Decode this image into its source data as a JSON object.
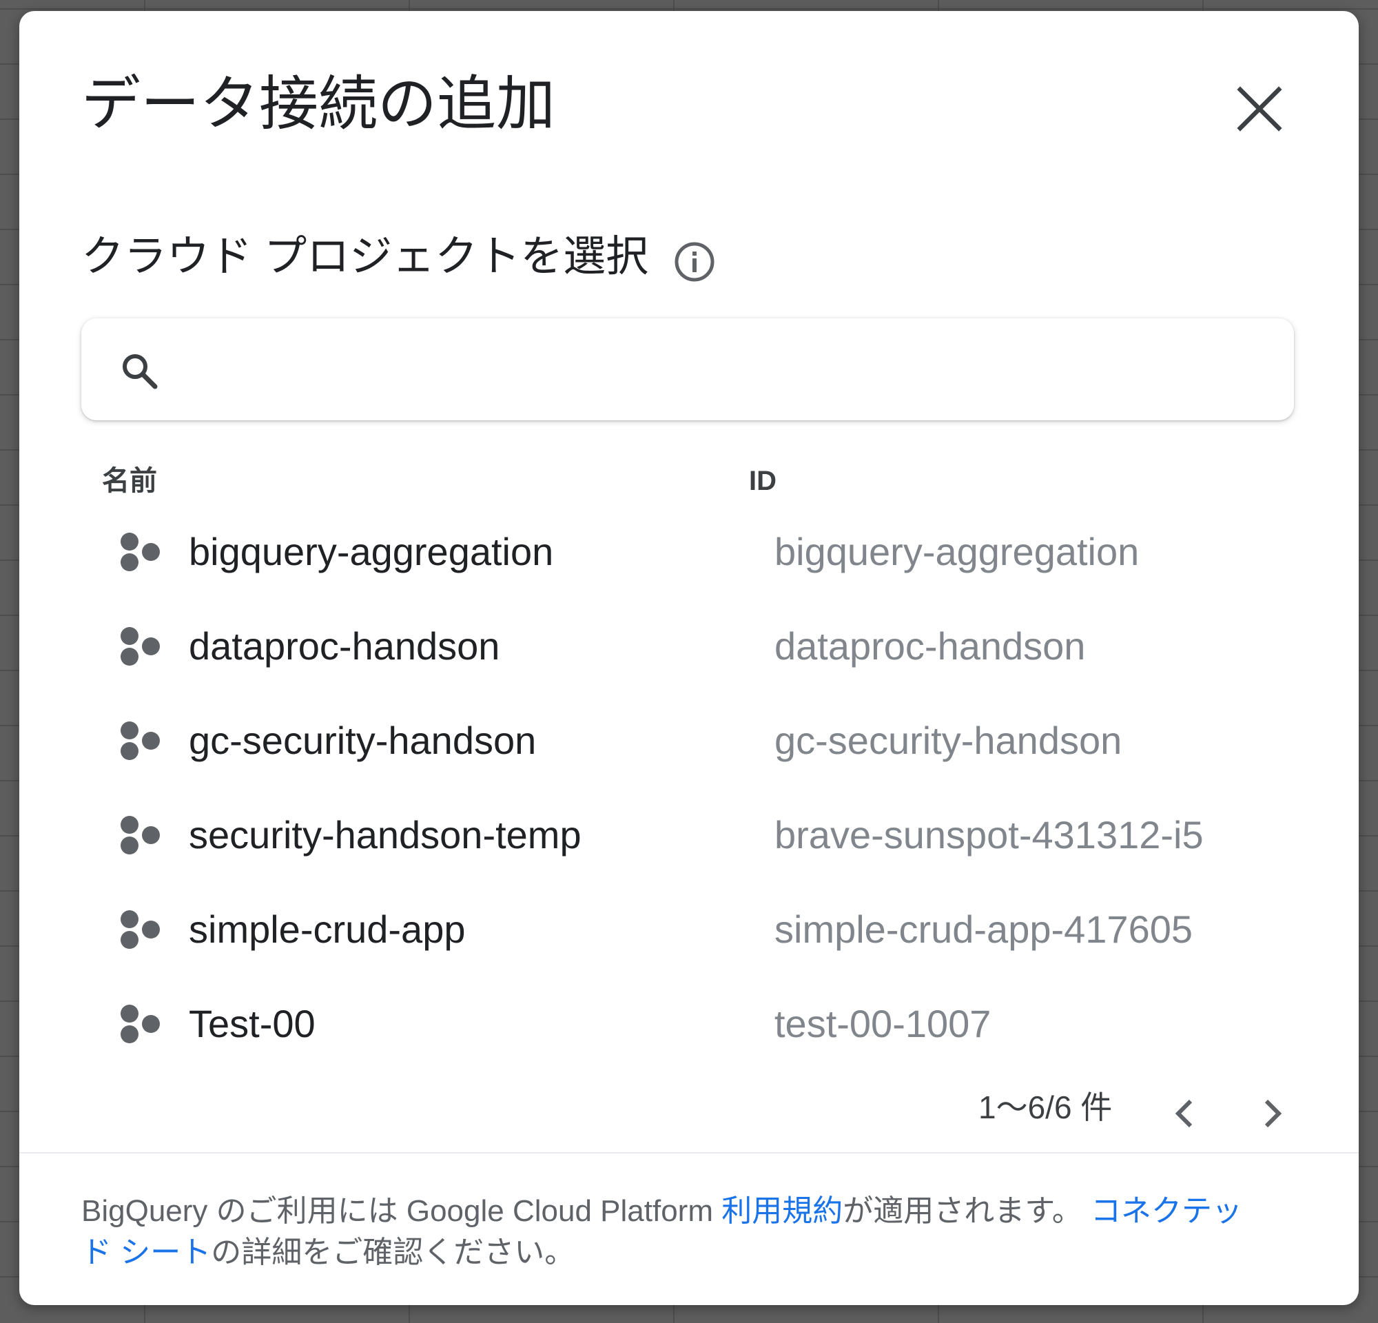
{
  "dialog": {
    "title": "データ接続の追加",
    "close_icon": "close-icon"
  },
  "section": {
    "label": "クラウド プロジェクトを選択",
    "info_icon": "info-icon"
  },
  "search": {
    "icon": "search-icon",
    "value": "",
    "placeholder": ""
  },
  "table": {
    "columns": [
      "名前",
      "ID"
    ],
    "rows": [
      {
        "name": "bigquery-aggregation",
        "id": "bigquery-aggregation",
        "icon": "project-icon"
      },
      {
        "name": "dataproc-handson",
        "id": "dataproc-handson",
        "icon": "project-icon"
      },
      {
        "name": "gc-security-handson",
        "id": "gc-security-handson",
        "icon": "project-icon"
      },
      {
        "name": "security-handson-temp",
        "id": "brave-sunspot-431312-i5",
        "icon": "project-icon"
      },
      {
        "name": "simple-crud-app",
        "id": "simple-crud-app-417605",
        "icon": "project-icon"
      },
      {
        "name": "Test-00",
        "id": "test-00-1007",
        "icon": "project-icon"
      }
    ]
  },
  "pagination": {
    "text": "1～6/6 件",
    "prev_icon": "chevron-left-icon",
    "next_icon": "chevron-right-icon"
  },
  "footer": {
    "text_before": "BigQuery のご利用には Google Cloud Platform ",
    "terms_link": "利用規約",
    "text_middle": "が適用されます。 ",
    "connected_link": "コネクテッド シート",
    "text_after": "の詳細をご確認ください。"
  },
  "colors": {
    "link": "#1a73e8",
    "primary_text": "#202124",
    "secondary_text": "#80868b",
    "icon": "#5f6368"
  }
}
